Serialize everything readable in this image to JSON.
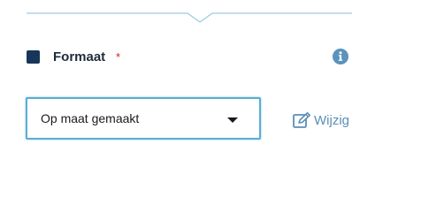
{
  "field": {
    "label": "Formaat",
    "required_marker": "*",
    "marker_color": "#17365a",
    "icons": [
      "info-icon",
      "chevron-down-icon",
      "edit-icon"
    ]
  },
  "select": {
    "value": "Op maat gemaakt"
  },
  "edit": {
    "label": "Wijzig"
  },
  "colors": {
    "border_focus": "#5aaed3",
    "link": "#5a8fb7",
    "required": "#d0212b",
    "divider": "#9ccbe0"
  }
}
